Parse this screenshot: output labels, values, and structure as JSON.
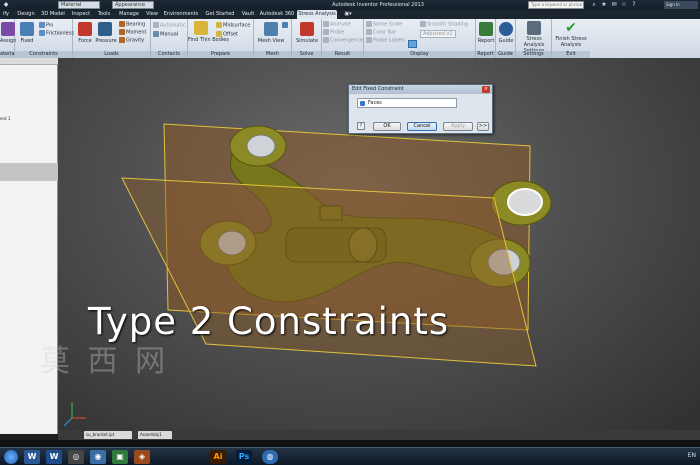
{
  "titlebar": {
    "qat_dropdown_1": "Material",
    "qat_dropdown_2": "Appearance",
    "title": "Autodesk Inventor Professional 2013",
    "search_placeholder": "Type a keyword or phrase",
    "user": "Sign In"
  },
  "tabs": [
    {
      "label": "ify"
    },
    {
      "label": "Design"
    },
    {
      "label": "3D Model"
    },
    {
      "label": "Inspect"
    },
    {
      "label": "Tools"
    },
    {
      "label": "Manage"
    },
    {
      "label": "View"
    },
    {
      "label": "Environments"
    },
    {
      "label": "Get Started"
    },
    {
      "label": "Vault"
    },
    {
      "label": "Autodesk 360"
    },
    {
      "label": "Stress Analysis"
    }
  ],
  "ribbon": {
    "material": {
      "btn": "Assign",
      "label": "aterial"
    },
    "constraints": {
      "fixed": "Fixed",
      "pin": "Pin",
      "frictionless": "Frictionless",
      "label": "Constraints"
    },
    "loads": {
      "force": "Force",
      "pressure": "Pressure",
      "bearing": "Bearing",
      "moment": "Moment",
      "gravity": "Gravity",
      "label": "Loads"
    },
    "contacts": {
      "automatic": "Automatic",
      "manual": "Manual",
      "label": "Contacts"
    },
    "prepare": {
      "find_thin": "Find Thin Bodies",
      "midsurface": "Midsurface",
      "offset": "Offset",
      "label": "Prepare"
    },
    "mesh": {
      "mesh_view": "Mesh View",
      "label": "Mesh"
    },
    "solve": {
      "simulate": "Simulate",
      "label": "Solve"
    },
    "result": {
      "animate": "Animate",
      "probe": "Probe",
      "convergence": "Convergence",
      "label": "Result"
    },
    "display": {
      "same_scale": "Same Scale",
      "color_bar": "Color Bar",
      "probe_labels": "Probe Labels",
      "smooth": "Smooth Shading",
      "adjusted": "Adjusted x1",
      "label": "Display"
    },
    "report": {
      "report": "Report",
      "guide": "Guide",
      "label_report": "Report",
      "label_guide": "Guide"
    },
    "settings": {
      "stress_settings": "Stress Analysis Settings",
      "label": "Settings"
    },
    "exit": {
      "finish": "Finish Stress Analysis",
      "label": "Exit"
    }
  },
  "browser": {
    "item": "ent 1"
  },
  "dialog": {
    "title": "Edit Fixed Constraint",
    "field": "Faces",
    "help": "?",
    "ok": "OK",
    "cancel": "Cancel",
    "apply": "Apply",
    "more": ">>"
  },
  "caption": "Type 2 Constraints",
  "watermark": "莫 西 网",
  "doc_tabs": [
    {
      "label": "su_bracket.ipt"
    },
    {
      "label": "Assembly1"
    }
  ],
  "taskbar": {
    "items": [
      "W",
      "W",
      "◎",
      "◉",
      "▣",
      "◈",
      "Ai",
      "Ps",
      "◍"
    ],
    "tray": "EN"
  },
  "colors": {
    "plane": "#8a5a2a",
    "plane_edge": "#e0c23a",
    "part": "#7a7a1e",
    "ribbon_accent": "#3a8c3a"
  }
}
